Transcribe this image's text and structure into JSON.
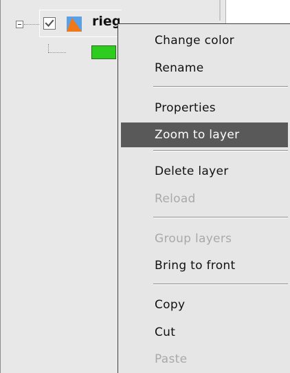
{
  "layer_tree": {
    "layer_name": "rieg",
    "layer_visible": true,
    "layer_type_icon": "vector-layer-icon",
    "legend_color": "#2ecc1f",
    "icon_colors": {
      "top": "#5aa0e6",
      "bottom": "#f07818"
    }
  },
  "context_menu": {
    "items": [
      {
        "label": "Change color",
        "state": "enabled"
      },
      {
        "label": "Rename",
        "state": "enabled"
      },
      {
        "label": "Properties",
        "state": "enabled"
      },
      {
        "label": "Zoom to layer",
        "state": "highlighted"
      },
      {
        "label": "Delete layer",
        "state": "enabled"
      },
      {
        "label": "Reload",
        "state": "disabled"
      },
      {
        "label": "Group layers",
        "state": "disabled"
      },
      {
        "label": "Bring to front",
        "state": "enabled"
      },
      {
        "label": "Copy",
        "state": "enabled"
      },
      {
        "label": "Cut",
        "state": "enabled"
      },
      {
        "label": "Paste",
        "state": "disabled"
      }
    ]
  },
  "colors": {
    "menu_background": "#e6e6e6",
    "highlight_background": "#595959",
    "highlight_text": "#ffffff",
    "disabled_text": "#a9a9a9",
    "panel_background": "#e8e8e8"
  }
}
